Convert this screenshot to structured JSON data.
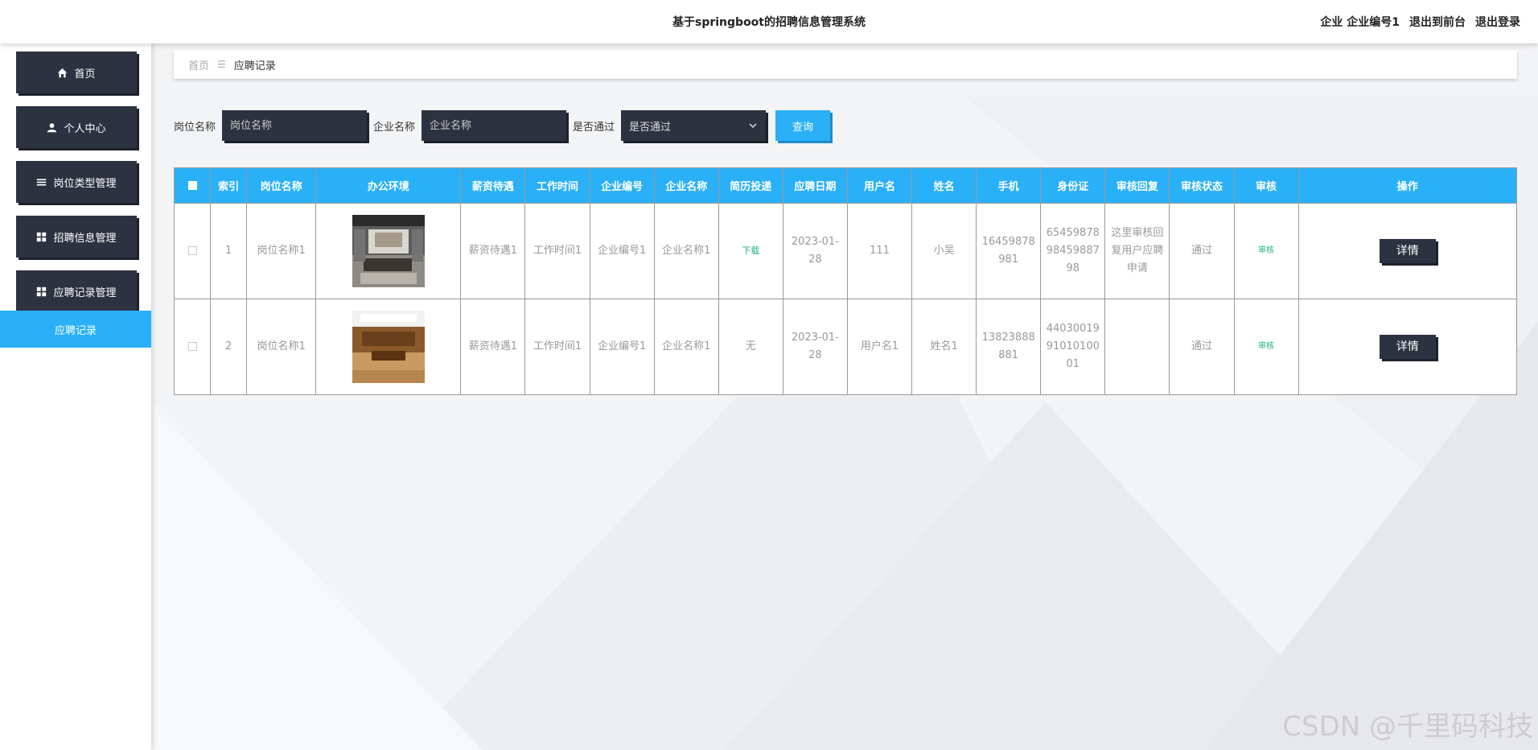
{
  "header": {
    "title": "基于springboot的招聘信息管理系统",
    "role": "企业",
    "user": "企业编号1",
    "to_front": "退出到前台",
    "logout": "退出登录"
  },
  "sidebar": {
    "items": [
      {
        "label": "首页",
        "icon": "home-icon"
      },
      {
        "label": "个人中心",
        "icon": "user-icon"
      },
      {
        "label": "岗位类型管理",
        "icon": "list-icon"
      },
      {
        "label": "招聘信息管理",
        "icon": "grid-icon"
      },
      {
        "label": "应聘记录管理",
        "icon": "grid-icon"
      }
    ],
    "active_sub": "应聘记录"
  },
  "breadcrumb": {
    "home": "首页",
    "current": "应聘记录"
  },
  "search": {
    "job_label": "岗位名称",
    "job_placeholder": "岗位名称",
    "company_label": "企业名称",
    "company_placeholder": "企业名称",
    "pass_label": "是否通过",
    "pass_value": "是否通过",
    "query_button": "查询"
  },
  "table": {
    "headers": [
      "索引",
      "岗位名称",
      "办公环境",
      "薪资待遇",
      "工作时间",
      "企业编号",
      "企业名称",
      "简历投递",
      "应聘日期",
      "用户名",
      "姓名",
      "手机",
      "身份证",
      "审核回复",
      "审核状态",
      "审核",
      "操作"
    ],
    "rows": [
      {
        "index": "1",
        "job": "岗位名称1",
        "salary": "薪资待遇1",
        "worktime": "工作时间1",
        "company_no": "企业编号1",
        "company_name": "企业名称1",
        "resume": "下载",
        "date": "2023-01-28",
        "username": "111",
        "name": "小吴",
        "phone": "16459878981",
        "idcard": "654598789845988798",
        "reply": "这里审核回复用户应聘申请",
        "status": "通过",
        "audit": "审核",
        "action": "详情"
      },
      {
        "index": "2",
        "job": "岗位名称1",
        "salary": "薪资待遇1",
        "worktime": "工作时间1",
        "company_no": "企业编号1",
        "company_name": "企业名称1",
        "resume": "无",
        "date": "2023-01-28",
        "username": "用户名1",
        "name": "姓名1",
        "phone": "13823888881",
        "idcard": "440300199101010001",
        "reply": "",
        "status": "通过",
        "audit": "审核",
        "action": "详情"
      }
    ]
  },
  "watermark": "CSDN @千里码科技",
  "colors": {
    "accent": "#29b0f7",
    "dark": "#2d3240",
    "green": "#1db57a"
  }
}
